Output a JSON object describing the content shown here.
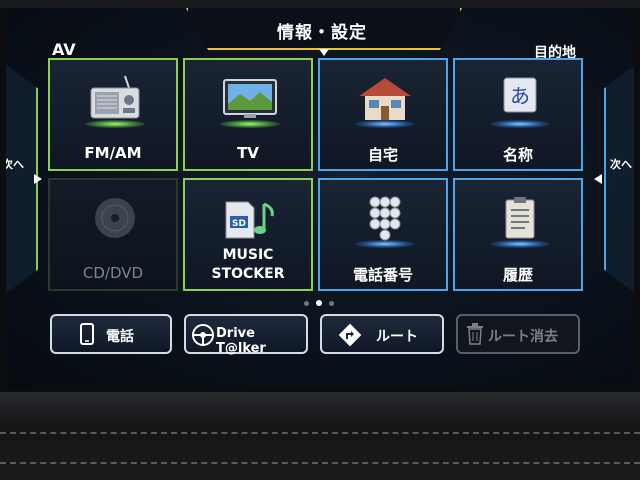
{
  "header": {
    "title": "情報・設定"
  },
  "sections": {
    "left": "AV",
    "right": "目的地"
  },
  "nav": {
    "prev_label": "次へ",
    "next_label": "次へ"
  },
  "tiles": [
    {
      "label": "FM/AM",
      "icon": "radio-icon",
      "group": "av"
    },
    {
      "label": "TV",
      "icon": "tv-icon",
      "group": "av"
    },
    {
      "label": "自宅",
      "icon": "house-icon",
      "group": "destination"
    },
    {
      "label": "名称",
      "icon": "hiragana-a-icon",
      "group": "destination"
    },
    {
      "label": "CD/DVD",
      "icon": "disc-icon",
      "group": "av",
      "state": "disabled"
    },
    {
      "label_line1": "MUSIC",
      "label_line2": "STOCKER",
      "icon": "sd-music-icon",
      "group": "av"
    },
    {
      "label": "電話番号",
      "icon": "keypad-icon",
      "group": "destination"
    },
    {
      "label": "履歴",
      "icon": "history-clipboard-icon",
      "group": "destination"
    }
  ],
  "pager": {
    "pages": 3,
    "current": 2
  },
  "buttons": {
    "phone": "電話",
    "drive_talker": "Drive T@lker",
    "route": "ルート",
    "route_delete": "ルート消去"
  },
  "colors": {
    "av_border": "#8bd04e",
    "destination_border": "#4fa3e6",
    "title_accent": "#e9c43a"
  }
}
